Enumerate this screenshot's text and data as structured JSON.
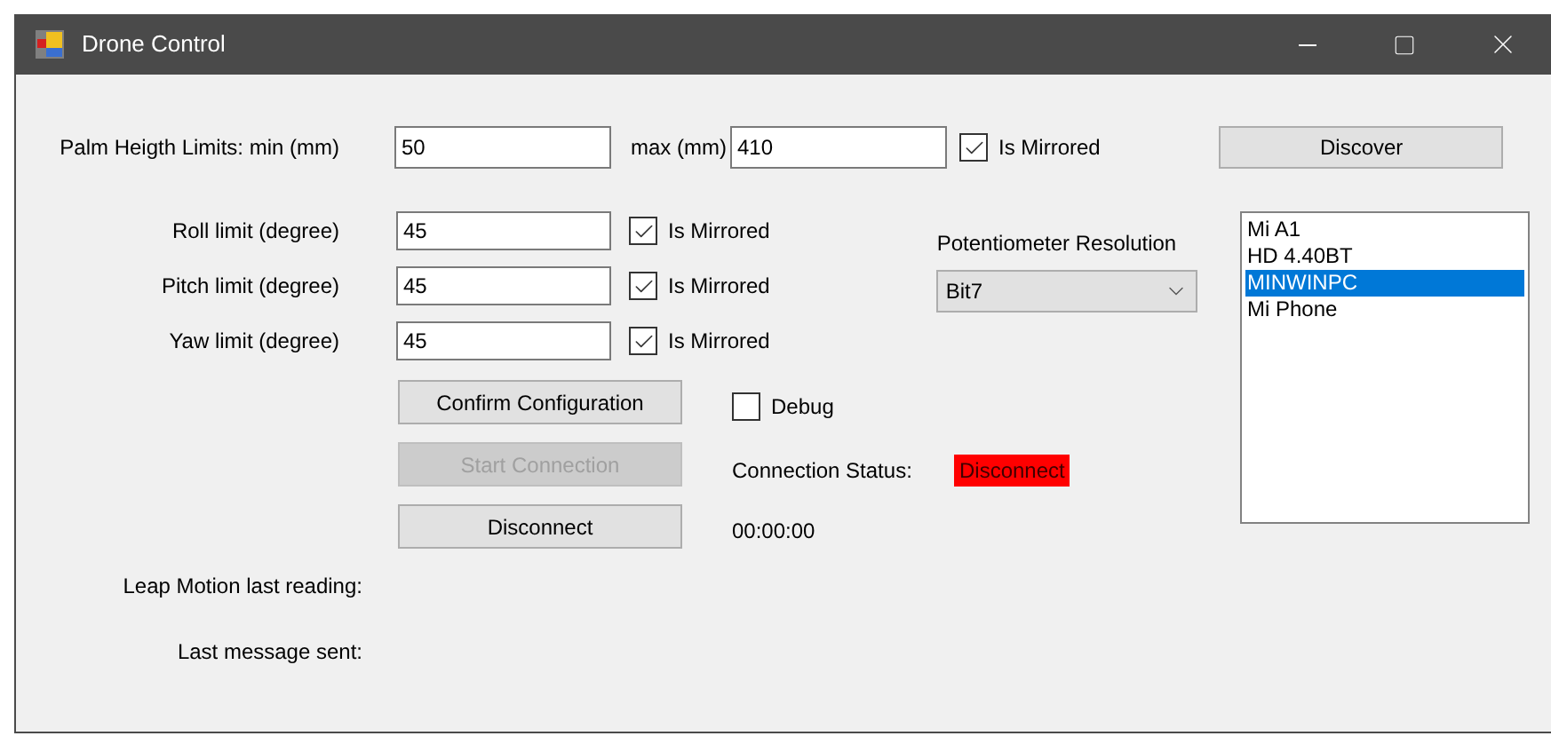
{
  "window": {
    "title": "Drone Control"
  },
  "palm_height": {
    "label": "Palm Heigth Limits: min (mm)",
    "min": "50",
    "max_label": "max (mm)",
    "max": "410",
    "mirrored": {
      "label": "Is Mirrored",
      "checked": true
    }
  },
  "discover_button": "Discover",
  "limits": [
    {
      "label": "Roll limit (degree)",
      "value": "45",
      "mirrored": {
        "label": "Is Mirrored",
        "checked": true
      }
    },
    {
      "label": "Pitch limit (degree)",
      "value": "45",
      "mirrored": {
        "label": "Is Mirrored",
        "checked": true
      }
    },
    {
      "label": "Yaw limit (degree)",
      "value": "45",
      "mirrored": {
        "label": "Is Mirrored",
        "checked": true
      }
    }
  ],
  "potentiometer": {
    "label": "Potentiometer Resolution",
    "value": "Bit7"
  },
  "devices": [
    {
      "name": "Mi A1",
      "selected": false
    },
    {
      "name": "HD 4.40BT",
      "selected": false
    },
    {
      "name": "MINWINPC",
      "selected": true
    },
    {
      "name": "Mi Phone",
      "selected": false
    }
  ],
  "buttons": [
    {
      "label": "Confirm Configuration",
      "disabled": false
    },
    {
      "label": "Start Connection",
      "disabled": true
    },
    {
      "label": "Disconnect",
      "disabled": false
    }
  ],
  "debug": {
    "label": "Debug",
    "checked": false
  },
  "connection": {
    "label": "Connection Status:",
    "status": "Disconnect"
  },
  "timer": "00:00:00",
  "readings": [
    {
      "label": "Leap Motion last reading:"
    },
    {
      "label": "Last message sent:"
    }
  ]
}
